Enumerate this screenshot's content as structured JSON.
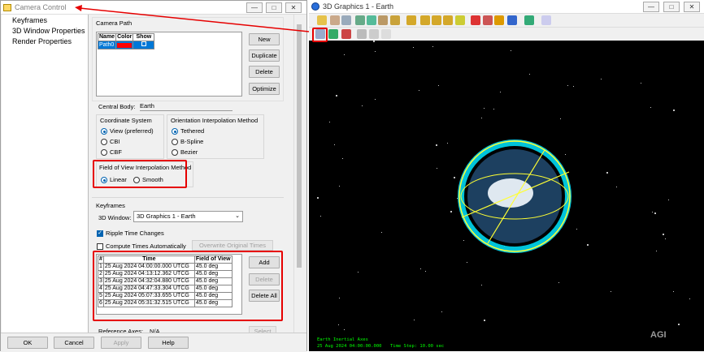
{
  "camera_control": {
    "title": "Camera Control",
    "nav": [
      "Keyframes",
      "3D Window Properties",
      "Render Properties"
    ],
    "camera_path": {
      "label": "Camera Path",
      "columns": [
        "Name",
        "Color",
        "Show"
      ],
      "rows": [
        {
          "name": "Path0",
          "color": "#ff0000",
          "show": "☐"
        }
      ],
      "buttons": [
        "New",
        "Duplicate",
        "Delete",
        "Optimize"
      ]
    },
    "central_body_label": "Central Body:",
    "central_body_value": "Earth",
    "coord_system": {
      "label": "Coordinate System",
      "options": [
        "View (preferred)",
        "CBI",
        "CBF"
      ],
      "selected": 0
    },
    "orient_interp": {
      "label": "Orientation Interpolation Method",
      "options": [
        "Tethered",
        "B-Spline",
        "Bezier"
      ],
      "selected": 0
    },
    "fov_interp": {
      "label": "Field of View Interpolation Method",
      "options": [
        "Linear",
        "Smooth"
      ],
      "selected": 0
    },
    "keyframes": {
      "label": "Keyframes",
      "window_label": "3D Window:",
      "window_value": "3D Graphics 1 - Earth",
      "ripple_label": "Ripple Time Changes",
      "compute_label": "Compute Times Automatically",
      "overwrite_label": "Overwrite Original Times",
      "columns": [
        "#",
        "Time",
        "Field of View"
      ],
      "rows": [
        [
          "1",
          "25 Aug 2024 04:00:00.000 UTCG",
          "45.0 deg"
        ],
        [
          "2",
          "25 Aug 2024 04:13:12.362 UTCG",
          "45.0 deg"
        ],
        [
          "3",
          "25 Aug 2024 04:32:04.880 UTCG",
          "45.0 deg"
        ],
        [
          "4",
          "25 Aug 2024 04:47:33.304 UTCG",
          "45.0 deg"
        ],
        [
          "5",
          "25 Aug 2024 05:07:33.655 UTCG",
          "45.0 deg"
        ],
        [
          "6",
          "25 Aug 2024 05:31:32.515 UTCG",
          "45.0 deg"
        ]
      ],
      "buttons": [
        "Add",
        "Delete",
        "Delete All"
      ]
    },
    "ref_axes_label": "Reference Axes:",
    "ref_axes_value": "N/A",
    "select_label": "Select",
    "footer_buttons": [
      "OK",
      "Cancel",
      "Apply",
      "Help"
    ]
  },
  "graphics_window": {
    "title": "3D Graphics 1 - Earth",
    "status_line1": "Earth Inertial Axes",
    "status_line2": "25 Aug 2024 04:00:00.000",
    "status_line3": "Time Step: 10.00 sec",
    "watermark": "AGI"
  },
  "window_controls": {
    "minimize": "—",
    "maximize": "□",
    "close": "✕"
  },
  "colors": {
    "highlight_box": "#e60000",
    "selection": "#0078d7",
    "orbit": "#00e5ff",
    "ring": "#ffff33"
  }
}
